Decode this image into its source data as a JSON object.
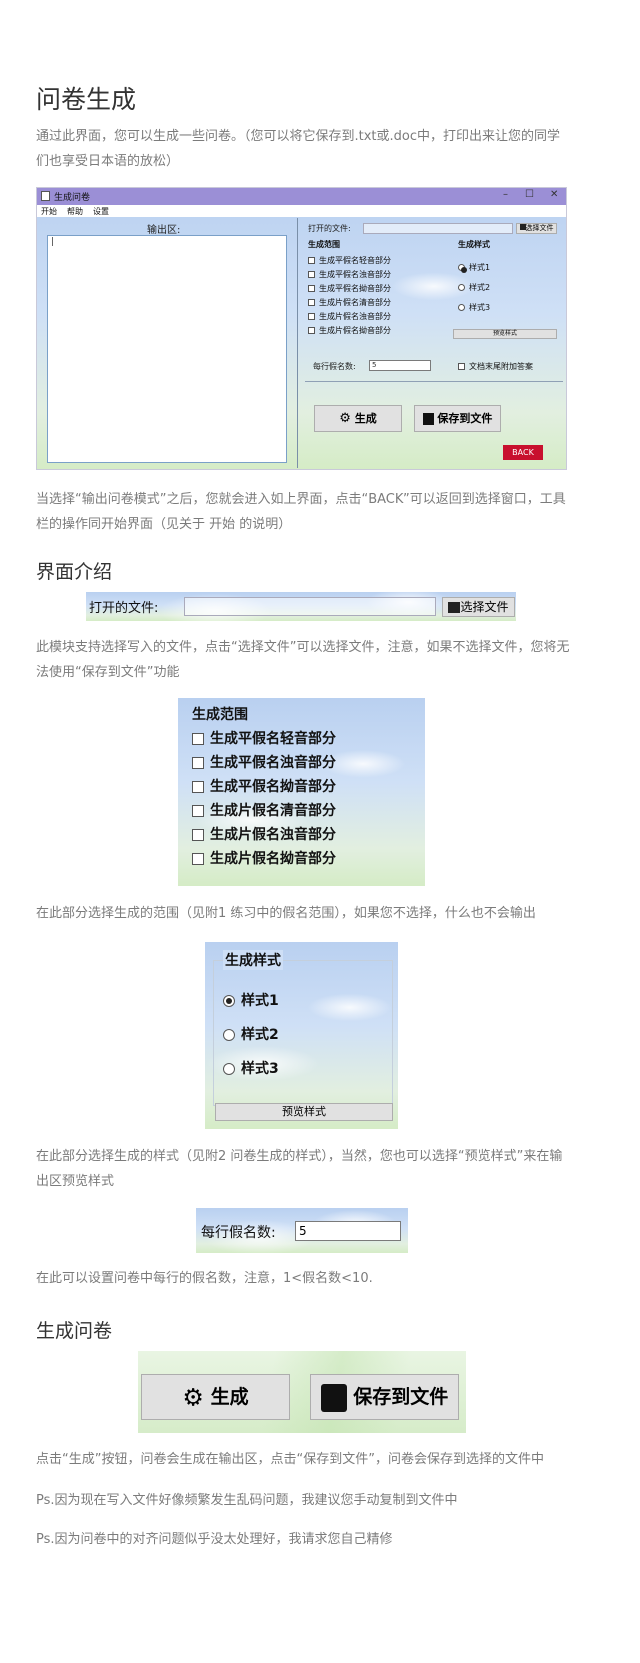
{
  "title": "问卷生成",
  "intro": "通过此界面，您可以生成一些问卷。（您可以将它保存到.txt或.doc中，打印出来让您的同学们也享受日本语的放松）",
  "window": {
    "title": "生成问卷",
    "controls": [
      "–",
      "☐",
      "✕"
    ],
    "menu": [
      "开始",
      "帮助",
      "设置"
    ],
    "output_label": "输出区:",
    "output_value": "|",
    "open_file_label": "打开的文件:",
    "choose_file": "选择文件",
    "range_title": "生成范围",
    "range_items": [
      "生成平假名轻音部分",
      "生成平假名浊音部分",
      "生成平假名拗音部分",
      "生成片假名清音部分",
      "生成片假名浊音部分",
      "生成片假名拗音部分"
    ],
    "style_title": "生成样式",
    "style_items": [
      "样式1",
      "样式2",
      "样式3"
    ],
    "preview": "预览样式",
    "per_line_label": "每行假名数:",
    "per_line_value": "5",
    "append_answer": "文档末尾附加答案",
    "generate": "生成",
    "save": "保存到文件",
    "back": "BACK"
  },
  "para_after_window": "当选择“输出问卷模式”之后，您就会进入如上界面，点击“BACK”可以返回到选择窗口，工具栏的操作同开始界面（见关于 开始 的说明）",
  "section_interface": "界面介绍",
  "file_panel": {
    "label": "打开的文件:",
    "button": "选择文件"
  },
  "para_file": "此模块支持选择写入的文件，点击“选择文件”可以选择文件，注意，如果不选择文件，您将无法使用“保存到文件”功能",
  "range_panel": {
    "title": "生成范围",
    "items": [
      "生成平假名轻音部分",
      "生成平假名浊音部分",
      "生成平假名拗音部分",
      "生成片假名清音部分",
      "生成片假名浊音部分",
      "生成片假名拗音部分"
    ]
  },
  "para_range": "在此部分选择生成的范围（见附1  练习中的假名范围），如果您不选择，什么也不会输出",
  "style_panel": {
    "title": "生成样式",
    "items": [
      "样式1",
      "样式2",
      "样式3"
    ],
    "preview": "预览样式"
  },
  "para_style": "在此部分选择生成的样式（见附2 问卷生成的样式），当然，您也可以选择“预览样式”来在输出区预览样式",
  "per_line_panel": {
    "label": "每行假名数:",
    "value": "5"
  },
  "para_per_line": "在此可以设置问卷中每行的假名数，注意，1<假名数<10.",
  "section_generate": "生成问卷",
  "gen_panel": {
    "generate": "生成",
    "save": "保存到文件"
  },
  "para_generate": "点击“生成”按钮，问卷会生成在输出区，点击“保存到文件”，问卷会保存到选择的文件中",
  "ps1": "Ps.因为现在写入文件好像频繁发生乱码问题，我建议您手动复制到文件中",
  "ps2": "Ps.因为问卷中的对齐问题似乎没太处理好，我请求您自己精修",
  "colors": {
    "titlebar": "#9b8fd6",
    "back_button": "#c8102e"
  }
}
